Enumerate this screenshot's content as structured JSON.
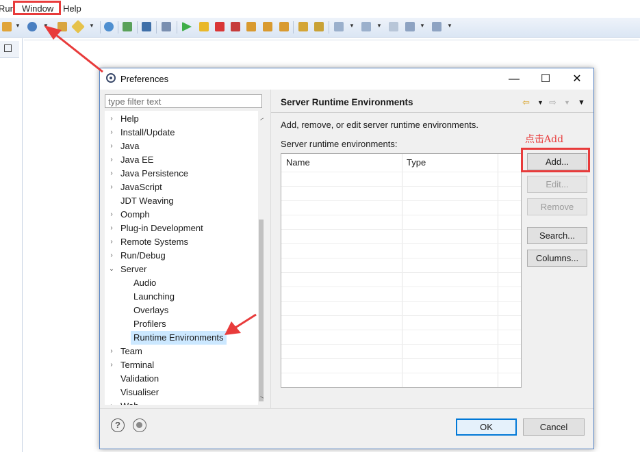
{
  "menubar": {
    "items": [
      {
        "label": "Run"
      },
      {
        "label": "Window"
      },
      {
        "label": "Help"
      }
    ]
  },
  "dialog": {
    "title": "Preferences",
    "window_controls": {
      "minimize": "—",
      "maximize": "☐",
      "close": "✕"
    },
    "filter_placeholder": "type filter text",
    "tree": [
      {
        "label": "Help",
        "expandable": true,
        "level": 0
      },
      {
        "label": "Install/Update",
        "expandable": true,
        "level": 0
      },
      {
        "label": "Java",
        "expandable": true,
        "level": 0
      },
      {
        "label": "Java EE",
        "expandable": true,
        "level": 0
      },
      {
        "label": "Java Persistence",
        "expandable": true,
        "level": 0
      },
      {
        "label": "JavaScript",
        "expandable": true,
        "level": 0
      },
      {
        "label": "JDT Weaving",
        "expandable": false,
        "level": 0
      },
      {
        "label": "Oomph",
        "expandable": true,
        "level": 0
      },
      {
        "label": "Plug-in Development",
        "expandable": true,
        "level": 0
      },
      {
        "label": "Remote Systems",
        "expandable": true,
        "level": 0
      },
      {
        "label": "Run/Debug",
        "expandable": true,
        "level": 0
      },
      {
        "label": "Server",
        "expandable": true,
        "expanded": true,
        "level": 0
      },
      {
        "label": "Audio",
        "expandable": false,
        "level": 1
      },
      {
        "label": "Launching",
        "expandable": false,
        "level": 1
      },
      {
        "label": "Overlays",
        "expandable": false,
        "level": 1
      },
      {
        "label": "Profilers",
        "expandable": false,
        "level": 1
      },
      {
        "label": "Runtime Environments",
        "expandable": false,
        "level": 1,
        "selected": true
      },
      {
        "label": "Team",
        "expandable": true,
        "level": 0
      },
      {
        "label": "Terminal",
        "expandable": true,
        "level": 0
      },
      {
        "label": "Validation",
        "expandable": false,
        "level": 0
      },
      {
        "label": "Visualiser",
        "expandable": false,
        "level": 0
      },
      {
        "label": "Web",
        "expandable": true,
        "level": 0
      }
    ],
    "page": {
      "title": "Server Runtime Environments",
      "description": "Add, remove, or edit server runtime environments.",
      "list_label": "Server runtime environments:",
      "columns": [
        "Name",
        "Type"
      ],
      "rows": []
    },
    "buttons": {
      "add": "Add...",
      "edit": "Edit...",
      "remove": "Remove",
      "search": "Search...",
      "columns": "Columns...",
      "ok": "OK",
      "cancel": "Cancel",
      "help": "?"
    }
  },
  "annotation": {
    "text": "点击Add",
    "color": "#e83b3b"
  },
  "colors": {
    "accent": "#0078d7",
    "selection": "#cce8ff",
    "highlight": "#e83b3b"
  }
}
